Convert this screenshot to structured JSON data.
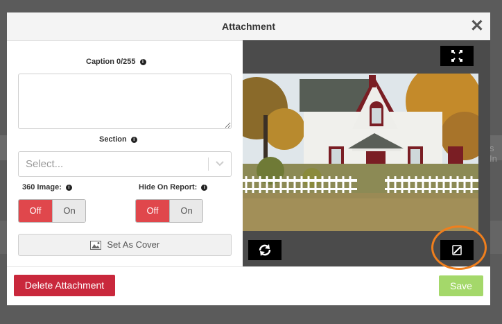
{
  "dialog": {
    "title": "Attachment",
    "close_symbol": "✕"
  },
  "caption": {
    "label": "Caption 0/255",
    "value": ""
  },
  "section": {
    "label": "Section",
    "placeholder": "Select..."
  },
  "image360": {
    "label": "360 Image:",
    "off_label": "Off",
    "on_label": "On",
    "state": "off"
  },
  "hide_on_report": {
    "label": "Hide On Report:",
    "off_label": "Off",
    "on_label": "On",
    "state": "off"
  },
  "set_cover_label": "Set As Cover",
  "footer": {
    "delete_label": "Delete Attachment",
    "save_label": "Save"
  },
  "background": {
    "partial_text": "s In"
  },
  "colors": {
    "accent_red": "#e0474c",
    "delete_red": "#c9283c",
    "save_green": "#a4d86a",
    "highlight_orange": "#f07f1d"
  },
  "icons": {
    "info": "info-icon",
    "fullscreen": "expand-icon",
    "rotate": "rotate-icon",
    "edit": "pencil-icon",
    "cover": "image-icon",
    "dropdown": "chevron-down-icon"
  }
}
